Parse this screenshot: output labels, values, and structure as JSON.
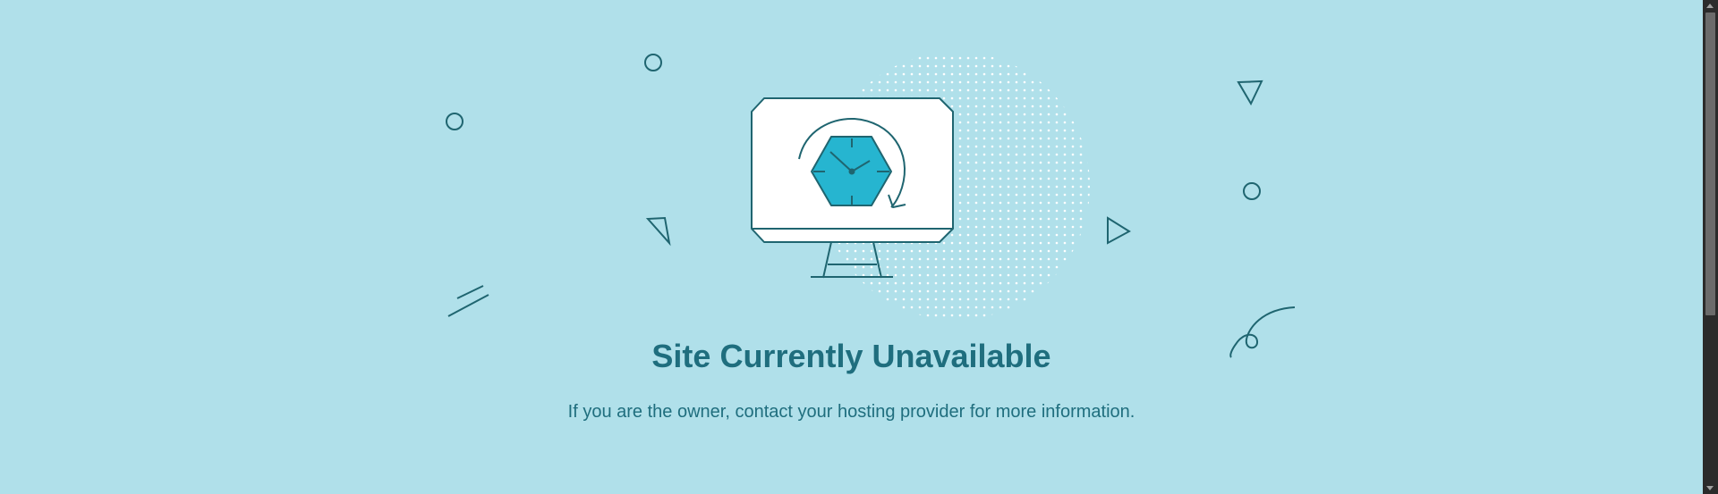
{
  "headline": "Site Currently Unavailable",
  "message": "If you are the owner, contact your hosting provider for more information.",
  "illustration": {
    "icon": "monitor-clock-icon"
  },
  "colors": {
    "background": "#b0e0ea",
    "text": "#1f6e7e",
    "accent": "#26b5d0",
    "stroke": "#1f6570"
  }
}
